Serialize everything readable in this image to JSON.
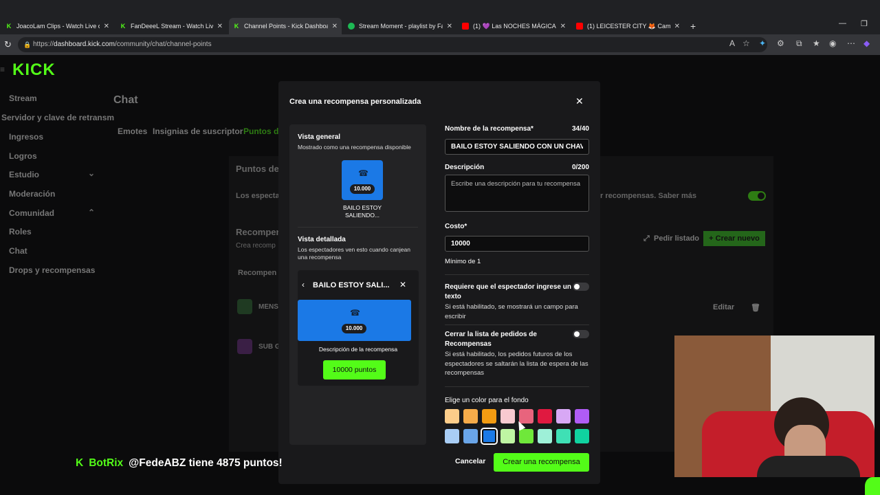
{
  "browser": {
    "tabs": [
      {
        "label": "JoacoLam Clips - Watch Live on Ki",
        "icon": "kick-icon"
      },
      {
        "label": "FanDeeeL Stream - Watch Live on",
        "icon": "kick-icon"
      },
      {
        "label": "Channel Points - Kick Dashboard",
        "icon": "kick-icon",
        "active": true
      },
      {
        "label": "Stream Moment - playlist by Fan",
        "icon": "spotify-icon"
      },
      {
        "label": "(1) 💜 Las NOCHES MÁGICAS del",
        "icon": "youtube-icon"
      },
      {
        "label": "(1) LEICESTER CITY 🦊 Campeón P",
        "icon": "youtube-icon"
      }
    ],
    "url_scheme": "https://",
    "url_host": "dashboard.kick.com",
    "url_path": "/community/chat/channel-points"
  },
  "sidebar": {
    "logo": "KICK",
    "items": [
      {
        "label": "Stream"
      },
      {
        "label": "Servidor y clave de retransm"
      },
      {
        "label": "Ingresos"
      },
      {
        "label": "Logros"
      },
      {
        "label": "Estudio"
      },
      {
        "label": "Moderación"
      },
      {
        "label": "Comunidad"
      },
      {
        "label": "Roles"
      },
      {
        "label": "Chat"
      },
      {
        "label": "Drops y recompensas"
      }
    ]
  },
  "background": {
    "page_title": "Chat",
    "tabs": [
      "Emotes",
      "Insignias de suscriptor",
      "Puntos de"
    ],
    "section_title": "Puntos del",
    "section_text": "Los espectad",
    "section_text_right": "r recompensas. Saber más",
    "rewards_title": "Recompen",
    "rewards_sub": "Crea recomp",
    "rewards_col": "Recompen",
    "btn_pedir": "Pedir listado",
    "btn_crear_nuevo": "Crear nuevo",
    "reward1": "MENS",
    "reward2": "SUB G",
    "btn_editar": "Editar"
  },
  "modal": {
    "title": "Crea una recompensa personalizada",
    "preview": {
      "overview_title": "Vista general",
      "overview_sub": "Mostrado como una recompensa disponible",
      "cost_badge": "10.000",
      "card_name": "BAILO ESTOY SALIENDO...",
      "detail_title": "Vista detallada",
      "detail_sub": "Los espectadores ven esto cuando canjean una recompensa",
      "detail_header": "BAILO ESTOY SALI...",
      "detail_cost": "10.000",
      "detail_desc": "Descripción de la recompensa",
      "points_button": "10000 puntos"
    },
    "form": {
      "name_label": "Nombre de la recompensa*",
      "name_count": "34/40",
      "name_value": "BAILO ESTOY SALIENDO CON UN CHAVO",
      "desc_label": "Descripción",
      "desc_count": "0/200",
      "desc_placeholder": "Escribe una descripción para tu recompensa",
      "cost_label": "Costo*",
      "cost_value": "10000",
      "cost_min": "Mínimo de 1",
      "input_req_label": "Requiere que el espectador ingrese un texto",
      "input_req_help": "Si está habilitado, se mostrará un campo para escribir",
      "close_queue_label": "Cerrar la lista de pedidos de Recompensas",
      "close_queue_help": "Si está habilitado, los pedidos futuros de los espectadores se saltarán la lista de espera de las recompensas",
      "color_label": "Elige un color para el fondo",
      "colors_row1": [
        "#fccd8a",
        "#f5ab4a",
        "#f39c12",
        "#f8c9d0",
        "#e8647d",
        "#e01940",
        "#d8a8f5",
        "#b05cf5"
      ],
      "colors_row2": [
        "#a9cdf5",
        "#6aa5e8",
        "#1b79e6",
        "#bff5a3",
        "#6fe83a",
        "#9ef0d8",
        "#3fe0b5",
        "#10d3a0"
      ],
      "selected_color": "#1b79e6"
    },
    "cancel": "Cancelar",
    "create": "Crear una recompensa"
  },
  "overlay": {
    "bot_icon": "K",
    "bot_name": "BotRix",
    "message": "@FedeABZ tiene 4875 puntos!"
  }
}
